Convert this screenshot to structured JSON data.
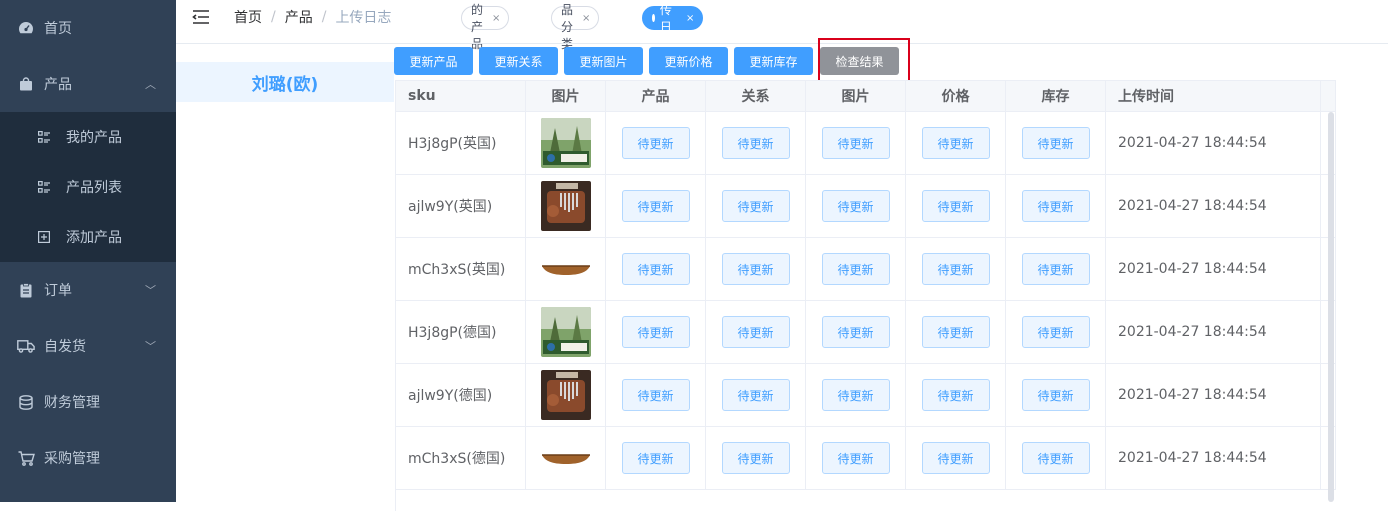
{
  "sidebar": {
    "home": "首页",
    "product": "产品",
    "sub": [
      "我的产品",
      "产品列表",
      "添加产品"
    ],
    "order": "订单",
    "self_ship": "自发货",
    "finance": "财务管理",
    "purchase": "采购管理"
  },
  "breadcrumb": [
    "首页",
    "产品",
    "上传日志"
  ],
  "tags": [
    {
      "label": "我的产品",
      "active": false
    },
    {
      "label": "产品分类",
      "active": false
    },
    {
      "label": "上传日志",
      "active": true
    }
  ],
  "store_name": "刘璐(欧)",
  "actions": [
    "更新产品",
    "更新关系",
    "更新图片",
    "更新价格",
    "更新库存",
    "检查结果"
  ],
  "columns": [
    "sku",
    "图片",
    "产品",
    "关系",
    "图片",
    "价格",
    "库存",
    "上传时间"
  ],
  "pending_label": "待更新",
  "rows": [
    {
      "sku": "H3j8gP(英国)",
      "image": "forest",
      "time": "2021-04-27 18:44:54"
    },
    {
      "sku": "ajlw9Y(英国)",
      "image": "kalimba",
      "time": "2021-04-27 18:44:54"
    },
    {
      "sku": "mCh3xS(英国)",
      "image": "bowl",
      "time": "2021-04-27 18:44:54"
    },
    {
      "sku": "H3j8gP(德国)",
      "image": "forest",
      "time": "2021-04-27 18:44:54"
    },
    {
      "sku": "ajlw9Y(德国)",
      "image": "kalimba",
      "time": "2021-04-27 18:44:54"
    },
    {
      "sku": "mCh3xS(德国)",
      "image": "bowl",
      "time": "2021-04-27 18:44:54"
    }
  ],
  "colors": {
    "sidebar_bg": "#304156",
    "submenu_bg": "#1f2d3d",
    "primary": "#409eff",
    "gray_button": "#909399",
    "highlight_border": "#d9001b"
  }
}
